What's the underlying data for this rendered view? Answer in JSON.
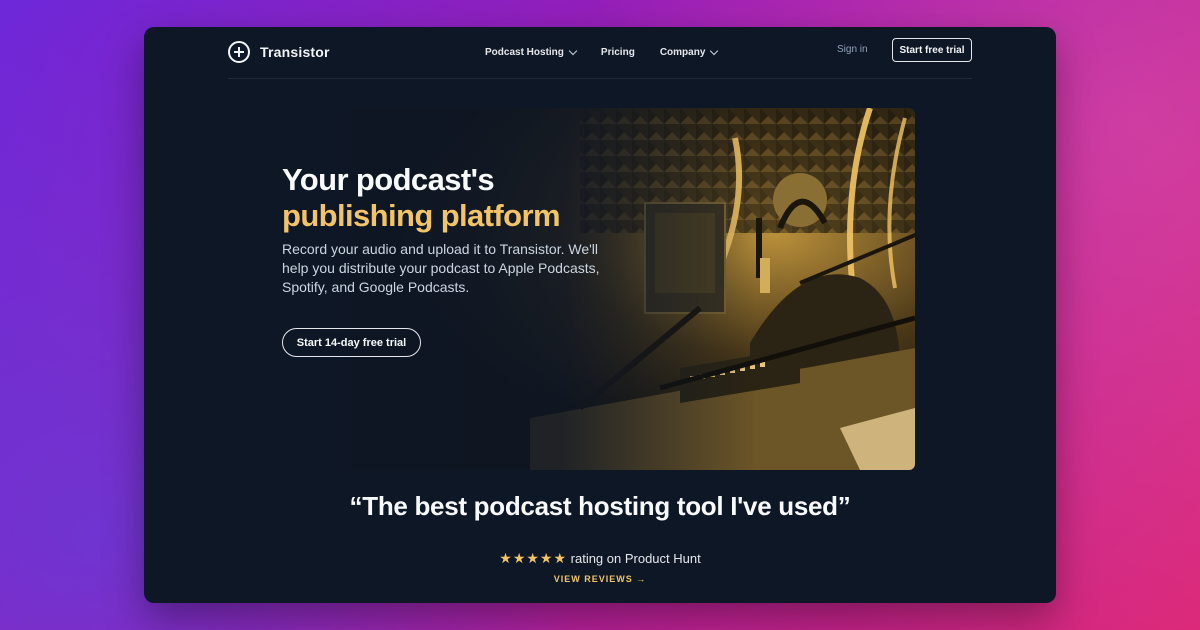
{
  "brand": {
    "name": "Transistor"
  },
  "nav": {
    "items": [
      {
        "label": "Podcast Hosting",
        "dropdown": true
      },
      {
        "label": "Pricing",
        "dropdown": false
      },
      {
        "label": "Company",
        "dropdown": true
      }
    ],
    "sign_in": "Sign in",
    "cta": "Start free trial"
  },
  "hero": {
    "title_line1": "Your podcast's",
    "title_line2": "publishing platform",
    "subtitle": "Record your audio and upload it to Transistor. We'll help you distribute your podcast to Apple Podcasts, Spotify, and Google Podcasts.",
    "cta": "Start 14-day free trial"
  },
  "testimonial": {
    "quote": "“The best podcast hosting tool I've used”",
    "stars": "★★★★★",
    "rating_text": " rating on Product Hunt",
    "link": "VIEW REVIEWS →"
  },
  "colors": {
    "accent": "#f2c466",
    "panel": "#0e1726"
  }
}
